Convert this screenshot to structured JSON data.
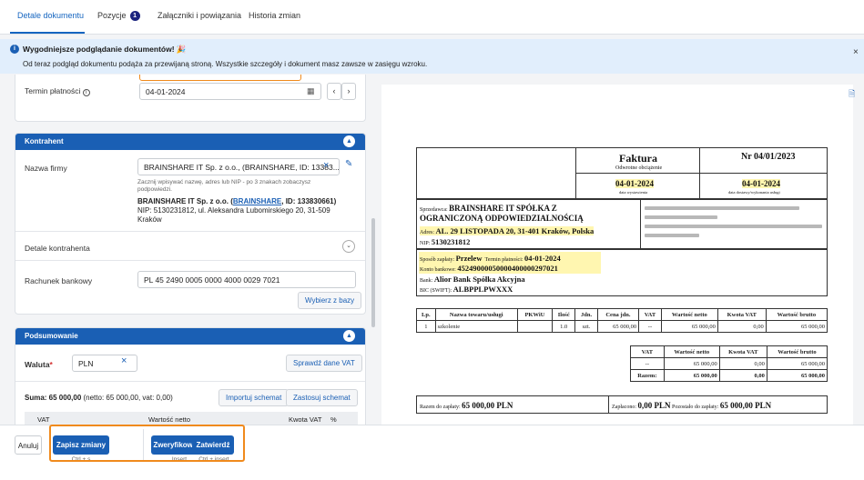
{
  "tabs": [
    {
      "label": "Detale dokumentu",
      "active": true
    },
    {
      "label": "Pozycje",
      "badge": "1"
    },
    {
      "label": "Załączniki i powiązania"
    },
    {
      "label": "Historia zmian"
    }
  ],
  "banner": {
    "title": "Wygodniejsze podglądanie dokumentów! 🎉",
    "text": "Od teraz podgląd dokumentu podąża za przewijaną stroną. Wszystkie szczegóły i dokument masz zawsze w zasięgu wzroku.",
    "close": "×"
  },
  "payment": {
    "due_label": "Termin płatności",
    "due_value": "04-01-2024",
    "calendar_icon": "calendar-icon",
    "prev": "‹",
    "next": "›"
  },
  "contractor": {
    "header": "Kontrahent",
    "company_label": "Nazwa firmy",
    "company_value": "BRAINSHARE IT Sp. z o.o., (BRAINSHARE, ID: 13383...",
    "company_hint": "Zacznij wpisywać nazwę, adres lub NIP - po 3 znakach zobaczysz podpowiedzi.",
    "company_name": "BRAINSHARE IT Sp. z o.o.",
    "company_link": "BRAINSHARE",
    "company_id": ", ID: 133830661)",
    "company_address": "NIP: 5130231812, ul. Aleksandra Lubomirskiego 20, 31-509 Kraków",
    "details_label": "Detale kontrahenta",
    "bank_label": "Rachunek bankowy",
    "bank_value": "PL 45 2490 0005 0000 4000 0029 7021",
    "choose_btn": "Wybierz z bazy"
  },
  "summary": {
    "header": "Podsumowanie",
    "currency_label": "Waluta",
    "currency_value": "PLN",
    "check_vat_btn": "Sprawdź dane VAT",
    "sum_text": "Suma: 65 000,00 (netto: 65 000,00, vat: 0,00)",
    "sum_bold": "Suma: 65 000,00",
    "sum_rest": " (netto: 65 000,00, vat: 0,00)",
    "import_btn": "Importuj schemat",
    "apply_btn": "Zastosuj schemat",
    "col_vat": "VAT",
    "col_net": "Wartość netto",
    "col_vat_amount": "Kwota VAT",
    "col_pct": "%"
  },
  "actions": {
    "cancel": "Anuluj",
    "save": "Zapisz zmiany",
    "save_shortcut": "Ctrl + s",
    "verified": "Zweryfikowane",
    "verified_shortcut": "Insert",
    "approve": "Zatwierdź",
    "approve_shortcut": "Ctrl + insert"
  },
  "invoice": {
    "title": "Faktura",
    "subtitle": "Odwrotne obciążenie",
    "number": "Nr 04/01/2023",
    "issue_date": "04-01-2024",
    "issue_label": "data wystawienia",
    "delivery_date": "04-01-2024",
    "delivery_label": "data dostawy/wykonania usługi",
    "seller_label": "Sprzedawca:",
    "seller_name_1": "BRAINSHARE IT SPÓŁKA Z",
    "seller_name_2": "OGRANICZONĄ ODPOWIEDZIALNOŚCIĄ",
    "seller_addr_label": "Adres:",
    "seller_addr": "AL. 29 LISTOPADA 20, 31-401 Kraków, Polska",
    "seller_nip_label": "NIP:",
    "seller_nip": "5130231812",
    "pay_method_label": "Sposób zapłaty:",
    "pay_method": "Przelew",
    "pay_due_label": "Termin płatności:",
    "pay_due": "04-01-2024",
    "account_label": "Konto bankowe:",
    "account": "45249000050000400000297021",
    "bank_label": "Bank:",
    "bank": "Alior Bank Spółka Akcyjna",
    "bic_label": "BIC (SWIFT):",
    "bic": "ALBPPLPWXXX",
    "items_head": [
      "Lp.",
      "Nazwa towaru/usługi",
      "PKWiU",
      "Ilość",
      "Jdn.",
      "Cena jdn.",
      "VAT",
      "Wartość netto",
      "Kwota VAT",
      "Wartość brutto"
    ],
    "items": [
      [
        "1",
        "szkolenie",
        "",
        "1.0",
        "szt.",
        "65 000,00",
        "--",
        "65 000,00",
        "0,00",
        "65 000,00"
      ]
    ],
    "totals_head": [
      "VAT",
      "Wartość netto",
      "Kwota VAT",
      "Wartość brutto"
    ],
    "totals_rows": [
      [
        "--",
        "65 000,00",
        "0,00",
        "65 000,00"
      ]
    ],
    "totals_sum": [
      "Razem:",
      "65 000,00",
      "0,00",
      "65 000,00"
    ],
    "to_pay_label": "Razem do zapłaty:",
    "to_pay": "65 000,00 PLN",
    "paid_label": "Zapłacono:",
    "paid": "0,00 PLN",
    "left_label": "Pozostało do zapłaty:",
    "left": "65 000,00 PLN"
  }
}
